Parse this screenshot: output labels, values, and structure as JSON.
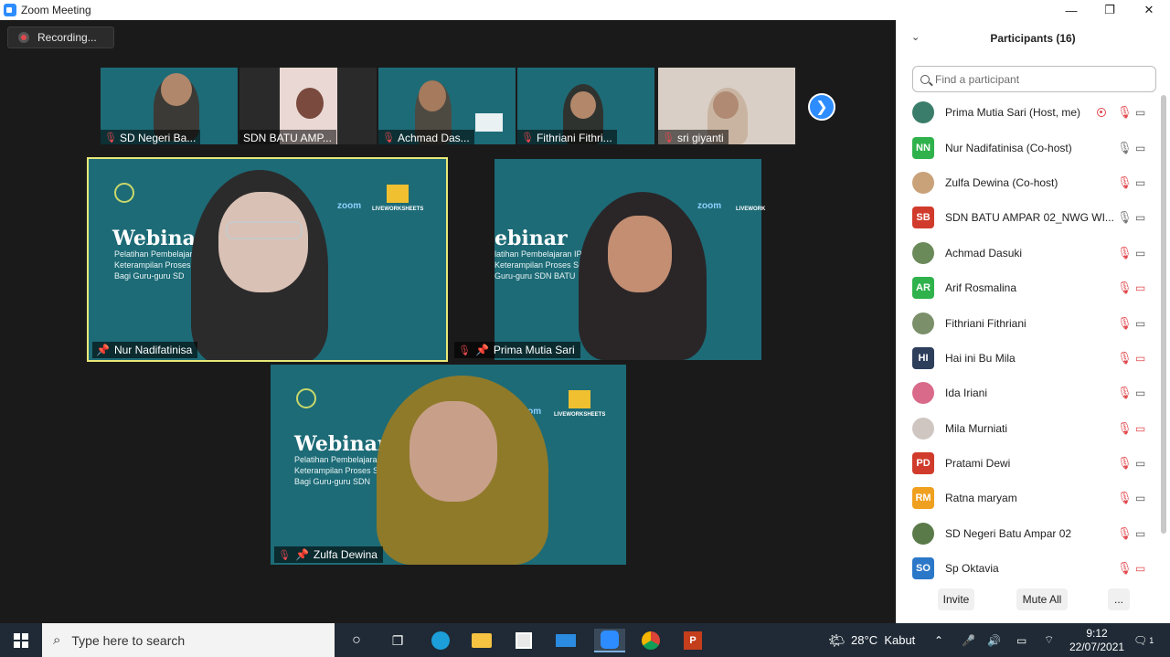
{
  "window": {
    "title": "Zoom Meeting",
    "controls": [
      "—",
      "❐",
      "✕"
    ]
  },
  "recording": {
    "label": "Recording..."
  },
  "thumbnails": [
    {
      "name": "SD Negeri Ba..."
    },
    {
      "name": "SDN BATU AMP..."
    },
    {
      "name": "Achmad Das..."
    },
    {
      "name": "Fithriani Fithri..."
    },
    {
      "name": "sri giyanti"
    }
  ],
  "main_tiles": [
    {
      "name": "Nur Nadifatinisa",
      "title": "Webinar",
      "sub": [
        "Pelatihan Pembelajaran",
        "Keterampilan Proses",
        "Bagi Guru-guru SD"
      ],
      "zoom": "zoom",
      "lw": "LIVEWORKSHEETS"
    },
    {
      "name": "Prima Mutia Sari",
      "title": "ebinar",
      "sub": [
        "latihan Pembelajaran IPA",
        "Keterampilan Proses Sains",
        "Guru-guru SDN BATU"
      ],
      "zoom": "zoom",
      "lw": "LIVEWORK"
    },
    {
      "name": "Zulfa Dewina",
      "title": "Webinar",
      "sub": [
        "Pelatihan Pembelajaran",
        "Keterampilan Proses S",
        "Bagi Guru-guru SDN"
      ],
      "zoom": "zoom",
      "lw": "LIVEWORKSHEETS"
    }
  ],
  "participants": {
    "header": "Participants (16)",
    "search_placeholder": "Find a participant",
    "list": [
      {
        "name": "Prima Mutia Sari (Host, me)",
        "initials": "",
        "color": "#3a7d6a",
        "recording": true,
        "mic": "off",
        "cam": "on"
      },
      {
        "name": "Nur Nadifatinisa (Co-host)",
        "initials": "NN",
        "color": "#2fb24c",
        "recording": false,
        "mic": "on",
        "cam": "on"
      },
      {
        "name": "Zulfa Dewina (Co-host)",
        "initials": "",
        "color": "#c9a27a",
        "recording": false,
        "mic": "off",
        "cam": "on"
      },
      {
        "name": "SDN BATU AMPAR 02_NWG WI...",
        "initials": "SB",
        "color": "#d13b2b",
        "recording": false,
        "mic": "on",
        "cam": "on"
      },
      {
        "name": "Achmad Dasuki",
        "initials": "",
        "color": "#6b8a5a",
        "recording": false,
        "mic": "off",
        "cam": "on"
      },
      {
        "name": "Arif Rosmalina",
        "initials": "AR",
        "color": "#2fb24c",
        "recording": false,
        "mic": "off",
        "cam": "off"
      },
      {
        "name": "Fithriani Fithriani",
        "initials": "",
        "color": "#7a8f6a",
        "recording": false,
        "mic": "off",
        "cam": "on"
      },
      {
        "name": "Hai ini Bu Mila",
        "initials": "HI",
        "color": "#2e3f5c",
        "recording": false,
        "mic": "off",
        "cam": "off"
      },
      {
        "name": "Ida Iriani",
        "initials": "",
        "color": "#d96a8a",
        "recording": false,
        "mic": "off",
        "cam": "on"
      },
      {
        "name": "Mila Murniati",
        "initials": "",
        "color": "#cfc6c2",
        "recording": false,
        "mic": "off",
        "cam": "off"
      },
      {
        "name": "Pratami Dewi",
        "initials": "PD",
        "color": "#d13b2b",
        "recording": false,
        "mic": "off",
        "cam": "on"
      },
      {
        "name": "Ratna maryam",
        "initials": "RM",
        "color": "#f0a020",
        "recording": false,
        "mic": "off",
        "cam": "on"
      },
      {
        "name": "SD Negeri Batu Ampar 02",
        "initials": "",
        "color": "#5a7a4a",
        "recording": false,
        "mic": "off",
        "cam": "on"
      },
      {
        "name": "Sp Oktavia",
        "initials": "SO",
        "color": "#2b78c9",
        "recording": false,
        "mic": "off",
        "cam": "off"
      }
    ],
    "buttons": {
      "invite": "Invite",
      "mute_all": "Mute All",
      "more": "..."
    }
  },
  "taskbar": {
    "search_placeholder": "Type here to search",
    "weather": "28°C  Kabut",
    "time": "9:12",
    "date": "22/07/2021",
    "notification_count": "1"
  }
}
